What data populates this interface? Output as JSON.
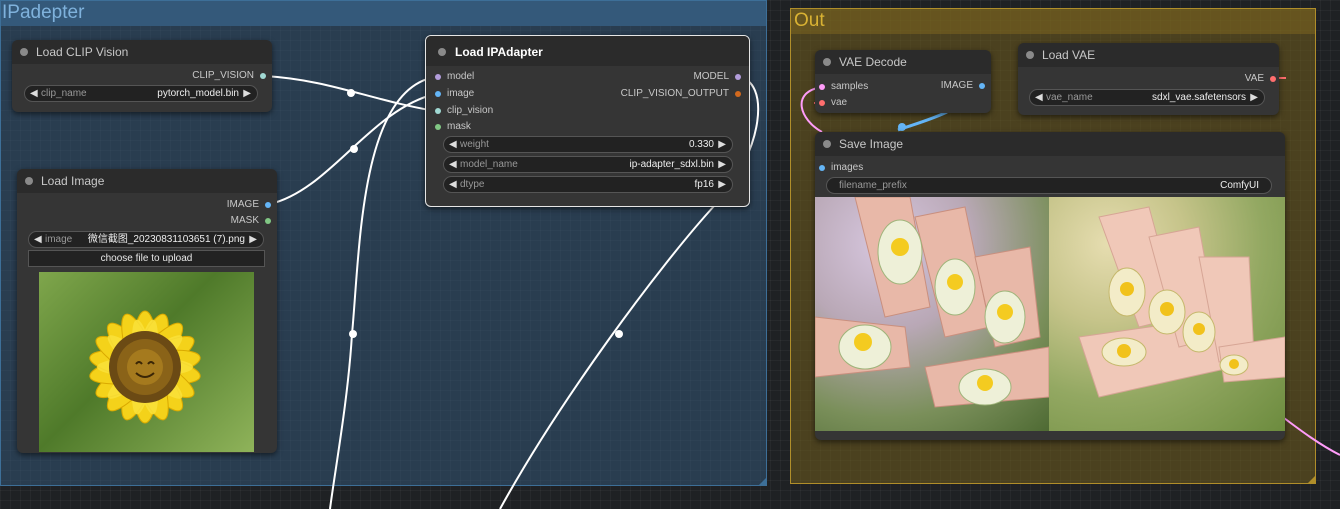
{
  "groups": {
    "ipadapter": {
      "title": "IPadepter"
    },
    "out": {
      "title": "Out"
    }
  },
  "nodes": {
    "load_clip_vision": {
      "title": "Load CLIP Vision",
      "output": "CLIP_VISION",
      "widget": {
        "label": "clip_name",
        "value": "pytorch_model.bin"
      }
    },
    "load_image": {
      "title": "Load Image",
      "outputs": [
        "IMAGE",
        "MASK"
      ],
      "widget": {
        "label": "image",
        "value": "微信截图_20230831103651 (7).png"
      },
      "upload_button": "choose file to upload"
    },
    "load_ipadapter": {
      "title": "Load IPAdapter",
      "inputs": [
        "model",
        "image",
        "clip_vision",
        "mask"
      ],
      "outputs": [
        "MODEL",
        "CLIP_VISION_OUTPUT"
      ],
      "widgets": [
        {
          "label": "weight",
          "value": "0.330"
        },
        {
          "label": "model_name",
          "value": "ip-adapter_sdxl.bin"
        },
        {
          "label": "dtype",
          "value": "fp16"
        }
      ]
    },
    "vae_decode": {
      "title": "VAE Decode",
      "inputs": [
        "samples",
        "vae"
      ],
      "output": "IMAGE"
    },
    "load_vae": {
      "title": "Load VAE",
      "output": "VAE",
      "widget": {
        "label": "vae_name",
        "value": "sdxl_vae.safetensors"
      }
    },
    "save_image": {
      "title": "Save Image",
      "input": "images",
      "widget": {
        "label": "filename_prefix",
        "value": "ComfyUI"
      }
    }
  },
  "icons": {
    "sunflower": "sunflower-image-icon",
    "nail_left": "nail-art-preview-left",
    "nail_right": "nail-art-preview-right"
  },
  "colors": {
    "model": "#b39ddb",
    "image": "#64b5f6",
    "clip_vision": "#a1d9d3",
    "mask": "#81c784",
    "clip_vision_output": "#d2691e",
    "latent": "#ff9cf9",
    "vae": "#ff6e6e",
    "wire": "#ffffff"
  }
}
